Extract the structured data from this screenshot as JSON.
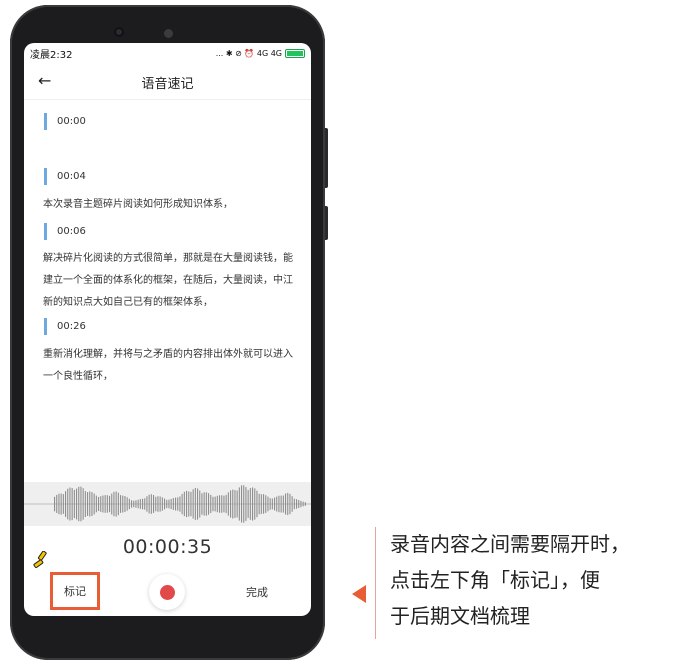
{
  "status_bar": {
    "time": "凌晨2:32",
    "icons": "... ✱ ⊘ ⏰ 4G 4G"
  },
  "header": {
    "title": "语音速记",
    "back_icon": "arrow-left-icon"
  },
  "transcript": [
    {
      "time": "00:00",
      "text": ""
    },
    {
      "time": "00:04",
      "text": "本次录音主题碎片阅读如何形成知识体系，"
    },
    {
      "time": "00:06",
      "text": "解决碎片化阅读的方式很简单，那就是在大量阅读钱，能建立一个全面的体系化的框架，在随后，大量阅读，中江新的知识点大如自己已有的框架体系，"
    },
    {
      "time": "00:26",
      "text": "重新消化理解，并将与之矛盾的内容排出体外就可以进入一个良性循环，"
    }
  ],
  "timer": "00:00:35",
  "controls": {
    "mark_label": "标记",
    "done_label": "完成",
    "record_color": "#e24a4a"
  },
  "annotation": {
    "lines": [
      "录音内容之间需要隔开时，",
      "点击左下角「标记」，便",
      "于后期文档梳理"
    ],
    "accent_color": "#e85d35"
  }
}
